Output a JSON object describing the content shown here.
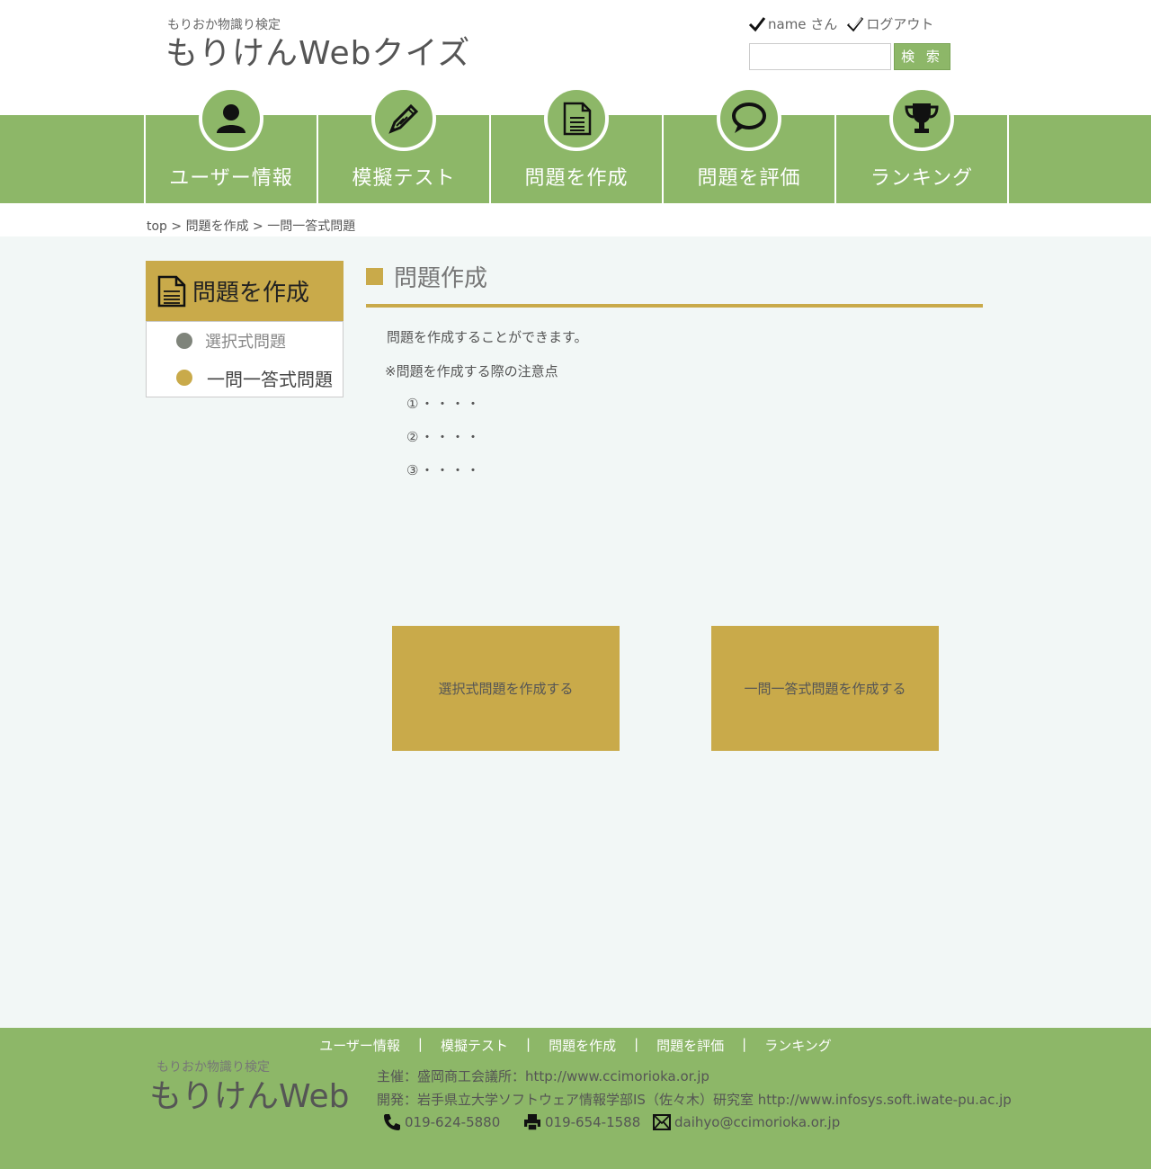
{
  "header": {
    "subtitle": "もりおか物識り検定",
    "title": "もりけんWebクイズ",
    "user_label": "name さん",
    "logout_label": "ログアウト",
    "search_placeholder": "",
    "search_button": "検 索"
  },
  "nav": {
    "items": [
      {
        "label": "ユーザー情報",
        "icon": "user-icon"
      },
      {
        "label": "模擬テスト",
        "icon": "pencil-icon"
      },
      {
        "label": "問題を作成",
        "icon": "document-icon"
      },
      {
        "label": "問題を評価",
        "icon": "speech-bubble-icon"
      },
      {
        "label": "ランキング",
        "icon": "trophy-icon"
      }
    ]
  },
  "breadcrumb": "top > 問題を作成 > 一問一答式問題",
  "sidebar": {
    "title": "問題を作成",
    "items": [
      {
        "label": "選択式問題",
        "dot_color": "#7f847b"
      },
      {
        "label": "一問一答式問題",
        "dot_color": "#c9aa4a"
      }
    ]
  },
  "main": {
    "title": "問題作成",
    "description": "問題を作成することができます。",
    "notes_heading": "※問題を作成する際の注意点",
    "notes": [
      "①・・・・",
      "②・・・・",
      "③・・・・"
    ],
    "buttons": [
      "選択式問題を作成する",
      "一問一答式問題を作成する"
    ]
  },
  "footer": {
    "nav": [
      "ユーザー情報",
      "模擬テスト",
      "問題を作成",
      "問題を評価",
      "ランキング"
    ],
    "separator": "|",
    "logo_subtitle": "もりおか物識り検定",
    "logo_title": "もりけんWeb",
    "organizer": "主催：盛岡商工会議所：http://www.ccimorioka.or.jp",
    "developer": "開発：岩手県立大学ソフトウェア情報学部IS（佐々木）研究室  http://www.infosys.soft.iwate-pu.ac.jp",
    "phone": "019-624-5880",
    "fax": "019-654-1588",
    "email": "daihyo@ccimorioka.or.jp"
  },
  "colors": {
    "green": "#8db768",
    "gold": "#c9aa4a",
    "content_bg": "#f2f7f6"
  }
}
